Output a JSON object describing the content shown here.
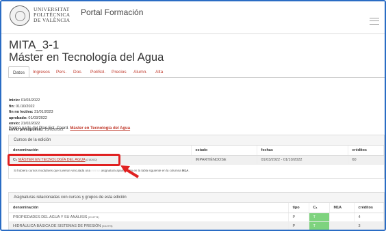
{
  "header": {
    "logo_line1": "UNIVERSITAT",
    "logo_line2": "POLITÈCNICA",
    "logo_line3": "DE VALÈNCIA",
    "portal": "Portal Formación",
    "menu_icon": "hamburger-icon"
  },
  "page": {
    "code": "MITA_3-1",
    "title": "Máster en Tecnología del Agua"
  },
  "tabs": [
    "Datos",
    "Ingresos",
    "Pers.",
    "Doc.",
    "PoliSol.",
    "Precios",
    "Alumn.",
    "Alta"
  ],
  "info": [
    {
      "label": "inicio:",
      "value": " 01/03/2022"
    },
    {
      "label": "fin:",
      "value": " 01/10/2022"
    },
    {
      "label": "fin no lectiva:",
      "value": " 31/01/2023"
    },
    {
      "label": "aprobado:",
      "value": " 01/03/2022"
    },
    {
      "label": "envío:",
      "value": " 21/02/2022"
    },
    {
      "label": "envío presupuesto:",
      "value": " 25/02/2022"
    }
  ],
  "forma": {
    "text": "Forma parte del Plan Est. Coord. ",
    "link": "Máster en Tecnología del Agua"
  },
  "cursos": {
    "heading": "Cursos de la edición",
    "headers": [
      "denominación",
      "estado",
      "fechas",
      "créditos"
    ],
    "row": {
      "prefix": "C₁",
      "name": "MÁSTER EN TECNOLOGÍA DEL AGUA",
      "code": "(2182632)",
      "estado": "IMPARTIÉNDOSE",
      "fechas": "01/03/2022 - 01/10/2022",
      "creditos": "60"
    },
    "note_start": "Si hubiera cursos modulares que tuvieran vinculada una ",
    "note_hidden": "misma",
    "note_end": " asignatura aparecerían en la tabla siguiente en la columna ",
    "note_bold": "M1A"
  },
  "asignaturas": {
    "heading": "Asignaturas relacionadas con cursos y grupos de esta edición",
    "headers": [
      "denominación",
      "tipo",
      "C₁",
      "M1A",
      "créditos"
    ],
    "rows": [
      {
        "name": "PROPIEDADES DEL AGUA Y SU ANÁLISIS",
        "code": "(IC12774)",
        "tipo": "P",
        "c1": "T",
        "m1a": "",
        "creditos": "4"
      },
      {
        "name": "HIDRÁULICA BÁSICA DE SISTEMAS DE PRESIÓN",
        "code": "(IC12775)",
        "tipo": "P",
        "c1": "T",
        "m1a": "",
        "creditos": "3"
      }
    ]
  },
  "colors": {
    "accent": "#c0392b",
    "highlight": "#e02020",
    "frame": "#2a6cc4",
    "check": "#7ed37e"
  }
}
